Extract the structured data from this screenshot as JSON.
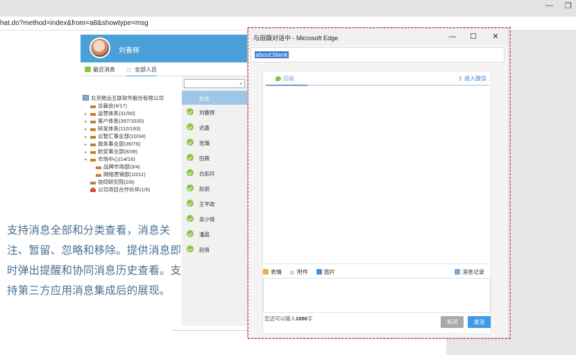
{
  "browser": {
    "address_text": "hat.do?method=index&from=a8&showtype=msg"
  },
  "messenger": {
    "user_name": "刘春辉",
    "tabs": [
      {
        "label": "最近消息"
      },
      {
        "label": "全部人员"
      }
    ],
    "tree": {
      "root": "北京致远互联软件股份有限公司",
      "items": [
        {
          "label": "总裁会(4/17)"
        },
        {
          "label": "运营体系(31/50)"
        },
        {
          "label": "客户体系(397/1035)"
        },
        {
          "label": "研发体系(110/183)"
        },
        {
          "label": "云智汇事业部(10/34)"
        },
        {
          "label": "政务事业部(35/76)"
        },
        {
          "label": "航安事业部(8/39)"
        },
        {
          "label": "市场中心(14/16)"
        },
        {
          "label": "品牌市场部(3/4)"
        },
        {
          "label": "网络营销部(10/11)"
        },
        {
          "label": "协同研究院(2/8)"
        },
        {
          "label": "公司项目合作伙伴(1/5)"
        }
      ]
    },
    "people_header": "姓名",
    "people": [
      "刘春辉",
      "迟鑫",
      "张瀚",
      "田薇",
      "白如月",
      "赵丽",
      "王平政",
      "吴少倩",
      "潘晨",
      "赵倩"
    ]
  },
  "promo_text": "支持消息全部和分类查看，消息关注、暂留、忽略和移除。提供消息即时弹出提醒和协同消息历史查看。支持第三方应用消息集成后的展现。",
  "popup": {
    "title": "与田薇对话中 - Microsoft Edge",
    "url": "about:blank",
    "chat_tab": "田薇",
    "enter_chat": "》进入致信",
    "tools": {
      "emoji": "表情",
      "attachment": "附件",
      "image": "图片",
      "history": "消息记录"
    },
    "limit_prefix": "您还可以输入",
    "limit_count": "1000",
    "limit_suffix": "字",
    "close_button": "关闭",
    "send_button": "发送"
  },
  "colors": {
    "header_blue": "#4aa0d8",
    "send_blue": "#3f9ae6",
    "check_green": "#8cc43f",
    "dashed_red": "#d23a3a",
    "promo_text": "#4c6f90"
  }
}
